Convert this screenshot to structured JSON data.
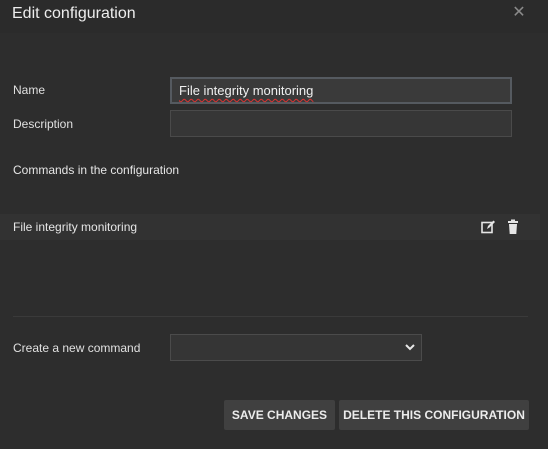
{
  "dialog": {
    "title": "Edit configuration",
    "close_icon": "close-icon"
  },
  "form": {
    "name_label": "Name",
    "name_value": "File integrity monitoring",
    "description_label": "Description",
    "description_value": ""
  },
  "commands": {
    "section_title": "Commands in the configuration",
    "items": [
      {
        "label": "File integrity monitoring",
        "edit_icon": "edit-icon",
        "delete_icon": "trash-icon"
      }
    ]
  },
  "new_command": {
    "label": "Create a new command",
    "selected_value": ""
  },
  "actions": {
    "save_label": "SAVE CHANGES",
    "delete_label": "DELETE THIS CONFIGURATION"
  }
}
